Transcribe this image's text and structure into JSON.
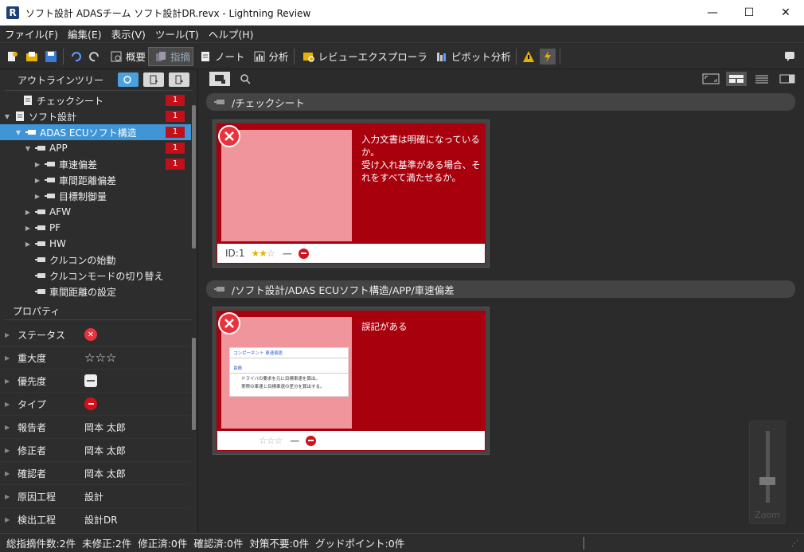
{
  "window": {
    "logo": "R",
    "title": "ソフト設計 ADASチーム ソフト設計DR.revx - Lightning Review",
    "minimize": "—",
    "maximize": "☐",
    "close": "✕"
  },
  "menu": [
    "ファイル(F)",
    "編集(E)",
    "表示(V)",
    "ツール(T)",
    "ヘルプ(H)"
  ],
  "toolbar": {
    "overview": "概要",
    "issues": "指摘",
    "note": "ノート",
    "analysis": "分析",
    "review_explorer": "レビューエクスプローラ",
    "pivot": "ピボット分析"
  },
  "outline": {
    "title": "アウトラインツリー",
    "items": [
      {
        "label": "チェックシート",
        "badge": "1"
      },
      {
        "label": "ソフト設計",
        "badge": "1"
      },
      {
        "label": "ADAS ECUソフト構造",
        "badge": "1"
      },
      {
        "label": "APP",
        "badge": "1"
      },
      {
        "label": "車速偏差",
        "badge": "1"
      },
      {
        "label": "車間距離偏差",
        "badge": ""
      },
      {
        "label": "目標制御量",
        "badge": ""
      },
      {
        "label": "AFW",
        "badge": ""
      },
      {
        "label": "PF",
        "badge": ""
      },
      {
        "label": "HW",
        "badge": ""
      },
      {
        "label": "クルコンの始動",
        "badge": ""
      },
      {
        "label": "クルコンモードの切り替え",
        "badge": ""
      },
      {
        "label": "車間距離の設定",
        "badge": ""
      }
    ]
  },
  "properties": {
    "title": "プロパティ",
    "rows": [
      {
        "label": "ステータス",
        "value": ""
      },
      {
        "label": "重大度",
        "value": "☆☆☆"
      },
      {
        "label": "優先度",
        "value": ""
      },
      {
        "label": "タイプ",
        "value": ""
      },
      {
        "label": "報告者",
        "value": "岡本 太郎"
      },
      {
        "label": "修正者",
        "value": "岡本 太郎"
      },
      {
        "label": "確認者",
        "value": "岡本 太郎"
      },
      {
        "label": "原因工程",
        "value": "設計"
      },
      {
        "label": "検出工程",
        "value": "設計DR"
      }
    ]
  },
  "groups": [
    {
      "path": "/チェックシート",
      "card": {
        "text": "入力文書は明確になっているか。\n受け入れ基準がある場合、それをすべて満たせるか。",
        "id": "ID:1",
        "stars_on": "★★",
        "stars_off": "☆",
        "dash": "—"
      }
    },
    {
      "path": "/ソフト設計/ADAS ECUソフト構造/APP/車速偏差",
      "card": {
        "text": "誤記がある",
        "id": "",
        "stars_on": "",
        "stars_off": "☆☆☆",
        "dash": "—",
        "preview": {
          "title": "コンポーネント 車速偏差",
          "section": "責務",
          "line1": "ドライバの要求を元に目標車速を算出。",
          "line2": "実際の車速と目標車速の差分を算出する。"
        }
      }
    }
  ],
  "zoom": {
    "label": "Zoom"
  },
  "status": "総指摘件数:2件  未修正:2件  修正済:0件  確認済:0件  対策不要:0件  グッドポイント:0件",
  "colors": {
    "accent": "#3f95d6",
    "card_red": "#a8000c",
    "badge_red": "#c0101a"
  }
}
